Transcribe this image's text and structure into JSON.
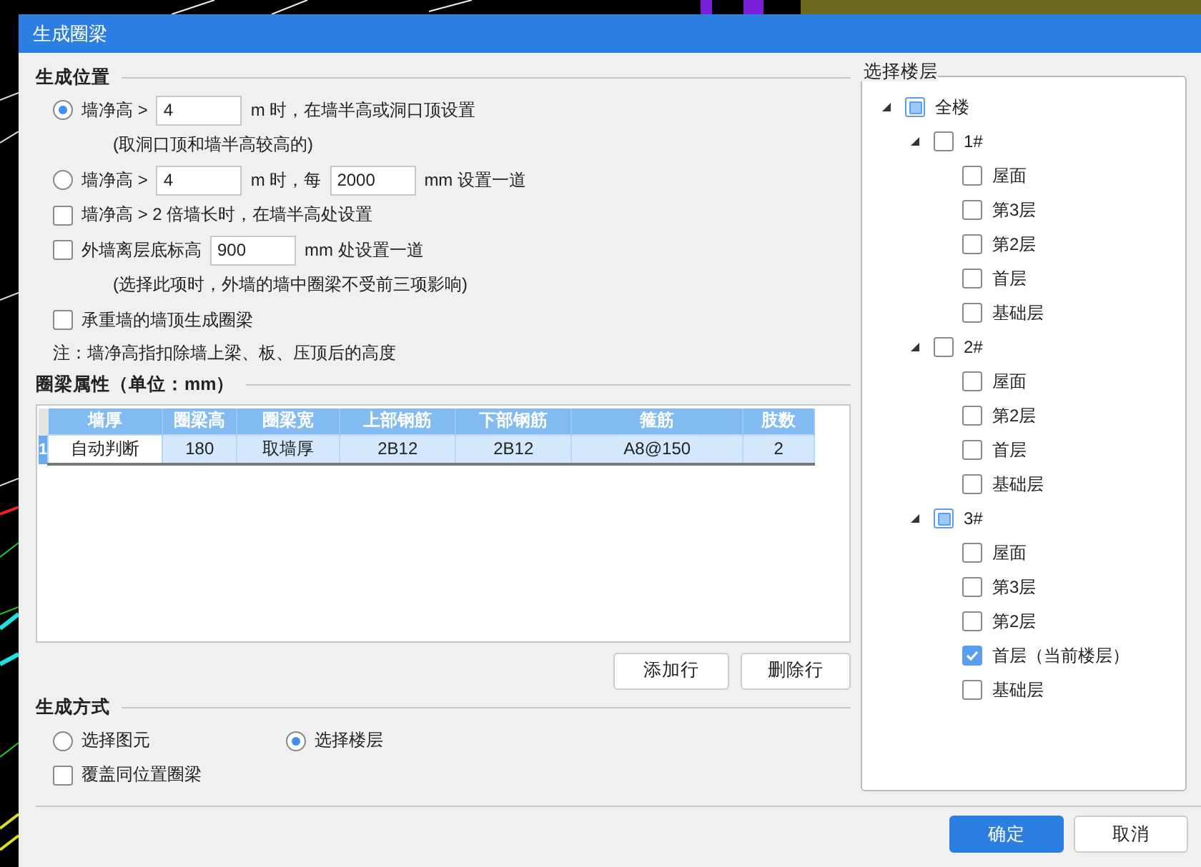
{
  "window": {
    "title": "生成圈梁"
  },
  "position": {
    "title": "生成位置",
    "options": [
      {
        "kind": "radio",
        "selected": true,
        "parts": [
          {
            "kind": "text",
            "text": "墙净高 >"
          },
          {
            "kind": "field",
            "value": "4"
          },
          {
            "kind": "text",
            "text": "m 时，在墙半高或洞口顶设置"
          }
        ]
      },
      {
        "kind": "note",
        "text": "(取洞口顶和墙半高较高的)"
      },
      {
        "kind": "radio",
        "selected": false,
        "parts": [
          {
            "kind": "text",
            "text": "墙净高 >"
          },
          {
            "kind": "field",
            "value": "4"
          },
          {
            "kind": "text",
            "text": "m 时，每"
          },
          {
            "kind": "field",
            "value": "2000"
          },
          {
            "kind": "text",
            "text": "mm 设置一道"
          }
        ]
      },
      {
        "kind": "checkbox",
        "checked": false,
        "parts": [
          {
            "kind": "text",
            "text": "墙净高 > 2 倍墙长时，在墙半高处设置"
          }
        ]
      },
      {
        "kind": "checkbox",
        "checked": false,
        "parts": [
          {
            "kind": "text",
            "text": "外墙离层底标高"
          },
          {
            "kind": "field",
            "value": "900"
          },
          {
            "kind": "text",
            "text": "mm 处设置一道"
          }
        ]
      },
      {
        "kind": "note",
        "text": "(选择此项时，外墙的墙中圈梁不受前三项影响)"
      },
      {
        "kind": "checkbox",
        "checked": false,
        "parts": [
          {
            "kind": "text",
            "text": "承重墙的墙顶生成圈梁"
          }
        ]
      },
      {
        "kind": "footnote",
        "text": "注：墙净高指扣除墙上梁、板、压顶后的高度"
      }
    ]
  },
  "properties": {
    "title": "圈梁属性（单位：mm）",
    "table": {
      "columns": [
        "墙厚",
        "圈梁高",
        "圈梁宽",
        "上部钢筋",
        "下部钢筋",
        "箍筋",
        "肢数"
      ],
      "rows": [
        {
          "number": "1",
          "selected": true,
          "cells": [
            {
              "text": "自动判断",
              "focused": true
            },
            {
              "text": "180",
              "focused": false
            },
            {
              "text": "取墙厚",
              "focused": false
            },
            {
              "text": "2B12",
              "focused": false
            },
            {
              "text": "2B12",
              "focused": false
            },
            {
              "text": "A8@150",
              "focused": false
            },
            {
              "text": "2",
              "focused": false
            }
          ]
        }
      ]
    },
    "buttons": [
      "添加行",
      "删除行"
    ]
  },
  "method": {
    "title": "生成方式",
    "options": [
      {
        "kind": "radio",
        "label": "选择图元",
        "selected": false
      },
      {
        "kind": "radio",
        "label": "选择楼层",
        "selected": true
      },
      {
        "kind": "checkbox",
        "label": "覆盖同位置圈梁",
        "checked": false
      }
    ]
  },
  "floors": {
    "title": "选择楼层",
    "tree": [
      {
        "label": "全楼",
        "checked": false,
        "partial": true,
        "expanded": true,
        "children": [
          {
            "label": "1#",
            "checked": false,
            "partial": false,
            "expanded": true,
            "children": [
              {
                "label": "屋面",
                "checked": false,
                "partial": false
              },
              {
                "label": "第3层",
                "checked": false,
                "partial": false
              },
              {
                "label": "第2层",
                "checked": false,
                "partial": false
              },
              {
                "label": "首层",
                "checked": false,
                "partial": false
              },
              {
                "label": "基础层",
                "checked": false,
                "partial": false
              }
            ]
          },
          {
            "label": "2#",
            "checked": false,
            "partial": false,
            "expanded": true,
            "children": [
              {
                "label": "屋面",
                "checked": false,
                "partial": false
              },
              {
                "label": "第2层",
                "checked": false,
                "partial": false
              },
              {
                "label": "首层",
                "checked": false,
                "partial": false
              },
              {
                "label": "基础层",
                "checked": false,
                "partial": false
              }
            ]
          },
          {
            "label": "3#",
            "checked": false,
            "partial": true,
            "expanded": true,
            "children": [
              {
                "label": "屋面",
                "checked": false,
                "partial": false
              },
              {
                "label": "第3层",
                "checked": false,
                "partial": false
              },
              {
                "label": "第2层",
                "checked": false,
                "partial": false
              },
              {
                "label": "首层（当前楼层）",
                "checked": true,
                "partial": false
              },
              {
                "label": "基础层",
                "checked": false,
                "partial": false
              }
            ]
          }
        ]
      }
    ]
  },
  "footer": [
    {
      "label": "确定",
      "primary": true
    },
    {
      "label": "取消",
      "primary": false
    }
  ]
}
